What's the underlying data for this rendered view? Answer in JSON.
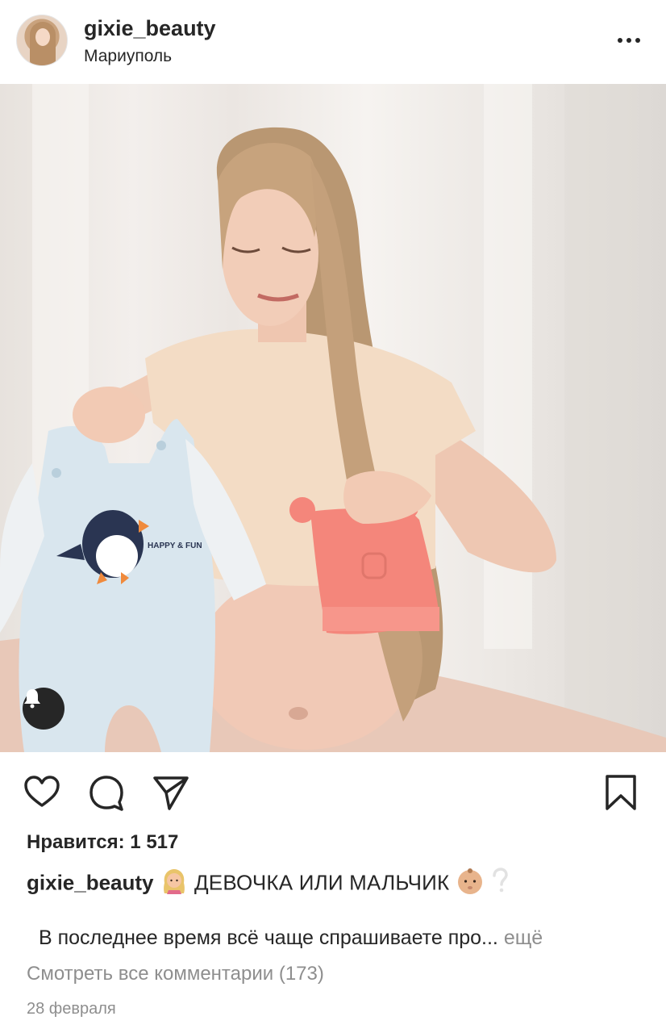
{
  "header": {
    "username": "gixie_beauty",
    "location": "Мариуполь"
  },
  "post": {
    "likes_label": "Нравится: 1 517",
    "caption_user": "gixie_beauty",
    "caption_text": "ДЕВОЧКА ИЛИ МАЛЬЧИК",
    "print_text": "HAPPY & FUN",
    "preview_text": "В последнее время всё чаще спрашиваете про...",
    "more_label": "ещё",
    "view_comments_label": "Смотреть все комментарии (173)",
    "date": "28 февраля"
  },
  "icons": {
    "menu": "more-dots-icon",
    "like": "heart-icon",
    "comment": "comment-bubble-icon",
    "share": "paper-plane-icon",
    "save": "bookmark-icon",
    "notification": "bell-icon"
  },
  "colors": {
    "text": "#262626",
    "muted": "#8e8e8e",
    "onesie": "#d9e6ee",
    "hat": "#f4867b",
    "top": "#f3dcc5"
  }
}
